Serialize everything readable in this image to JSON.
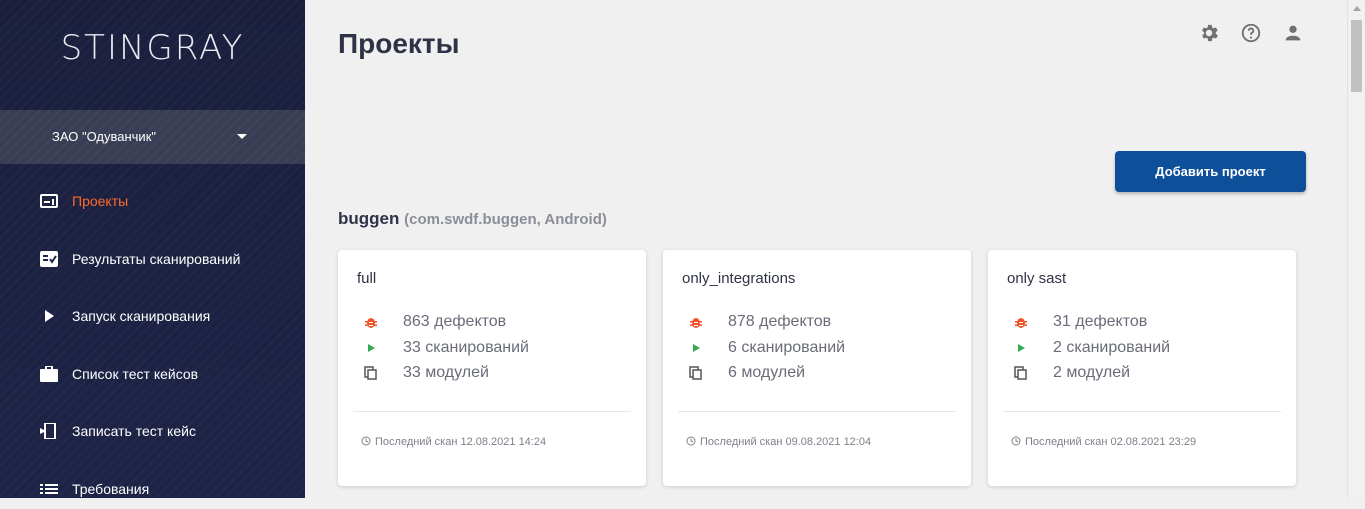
{
  "app": {
    "logo": "STINGRAY"
  },
  "org_selector": {
    "name": "ЗАО \"Одуванчик\""
  },
  "sidebar": {
    "items": [
      {
        "label": "Проекты",
        "icon": "projects-icon",
        "active": true
      },
      {
        "label": "Результаты сканирований",
        "icon": "scan-results-icon"
      },
      {
        "label": "Запуск сканирования",
        "icon": "play-icon"
      },
      {
        "label": "Список тест кейсов",
        "icon": "briefcase-icon"
      },
      {
        "label": "Записать тест кейс",
        "icon": "phone-record-icon"
      },
      {
        "label": "Требования",
        "icon": "list-icon"
      }
    ],
    "active_color": "#ff6a2a"
  },
  "header": {
    "title": "Проекты",
    "icons": [
      "gear-icon",
      "help-icon",
      "user-icon"
    ]
  },
  "actions": {
    "add_project": "Добавить проект",
    "accent": "#0d4f99"
  },
  "project_group": {
    "name": "buggen",
    "details": "(com.swdf.buggen, Android)",
    "cards": [
      {
        "title": "full",
        "defects": "863 дефектов",
        "scans": "33 сканирований",
        "modules": "33 модулей",
        "last_scan": "Последний скан 12.08.2021 14:24"
      },
      {
        "title": "only_integrations",
        "defects": "878 дефектов",
        "scans": "6 сканирований",
        "modules": "6 модулей",
        "last_scan": "Последний скан 09.08.2021 12:04"
      },
      {
        "title": "only sast",
        "defects": "31 дефектов",
        "scans": "2 сканирований",
        "modules": "2 модулей",
        "last_scan": "Последний скан 02.08.2021 23:29"
      }
    ]
  }
}
